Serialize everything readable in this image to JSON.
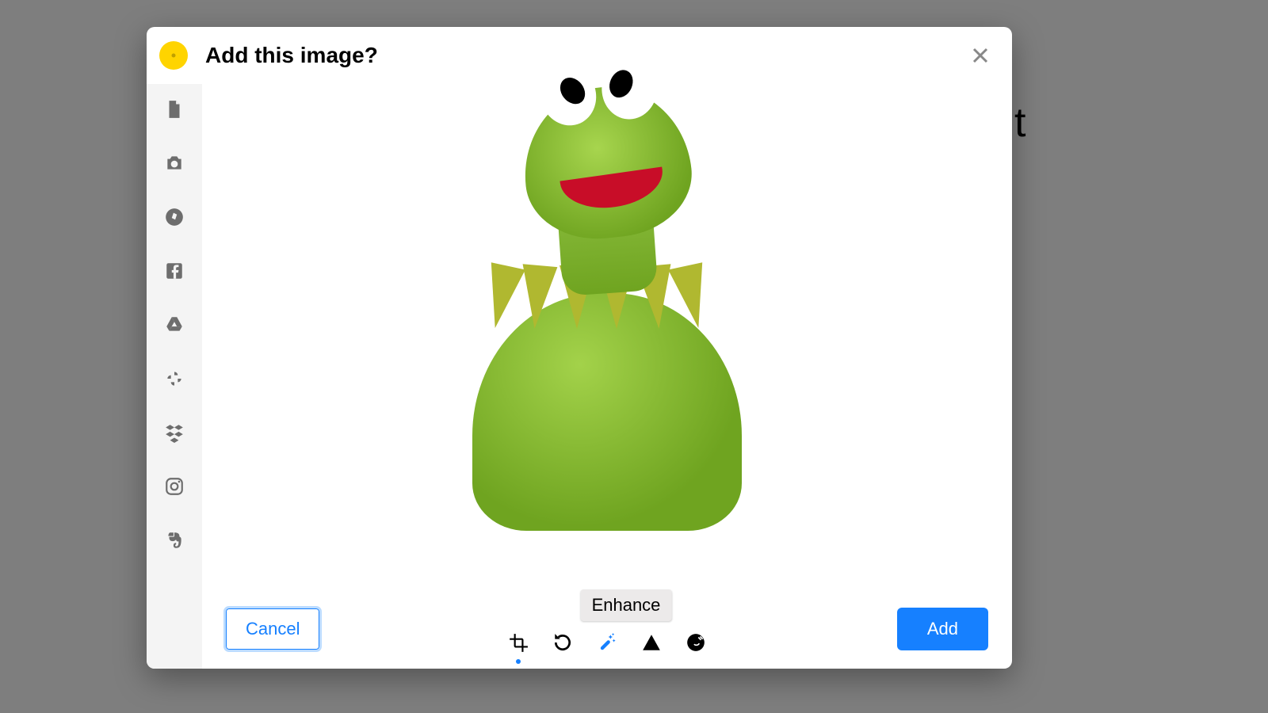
{
  "background": {
    "partial_text": "t"
  },
  "modal": {
    "title": "Add this image?",
    "sidebar": {
      "items": [
        {
          "name": "file-icon"
        },
        {
          "name": "camera-icon"
        },
        {
          "name": "compass-icon"
        },
        {
          "name": "facebook-icon"
        },
        {
          "name": "google-drive-icon"
        },
        {
          "name": "pinwheel-icon"
        },
        {
          "name": "dropbox-icon"
        },
        {
          "name": "instagram-icon"
        },
        {
          "name": "evernote-icon"
        }
      ]
    },
    "preview": {
      "description": "Green felt frog puppet with white bulging eyes, open red mouth, and a pointed collar"
    },
    "tools": {
      "items": [
        {
          "name": "crop-icon",
          "selected": true
        },
        {
          "name": "rotate-icon",
          "selected": false
        },
        {
          "name": "enhance-icon",
          "selected": false,
          "hover": true
        },
        {
          "name": "filters-icon",
          "selected": false
        },
        {
          "name": "alt-text-icon",
          "selected": false
        }
      ],
      "tooltip": "Enhance"
    },
    "buttons": {
      "cancel": "Cancel",
      "add": "Add"
    },
    "colors": {
      "accent": "#1680ff",
      "logo": "#ffd400"
    }
  }
}
